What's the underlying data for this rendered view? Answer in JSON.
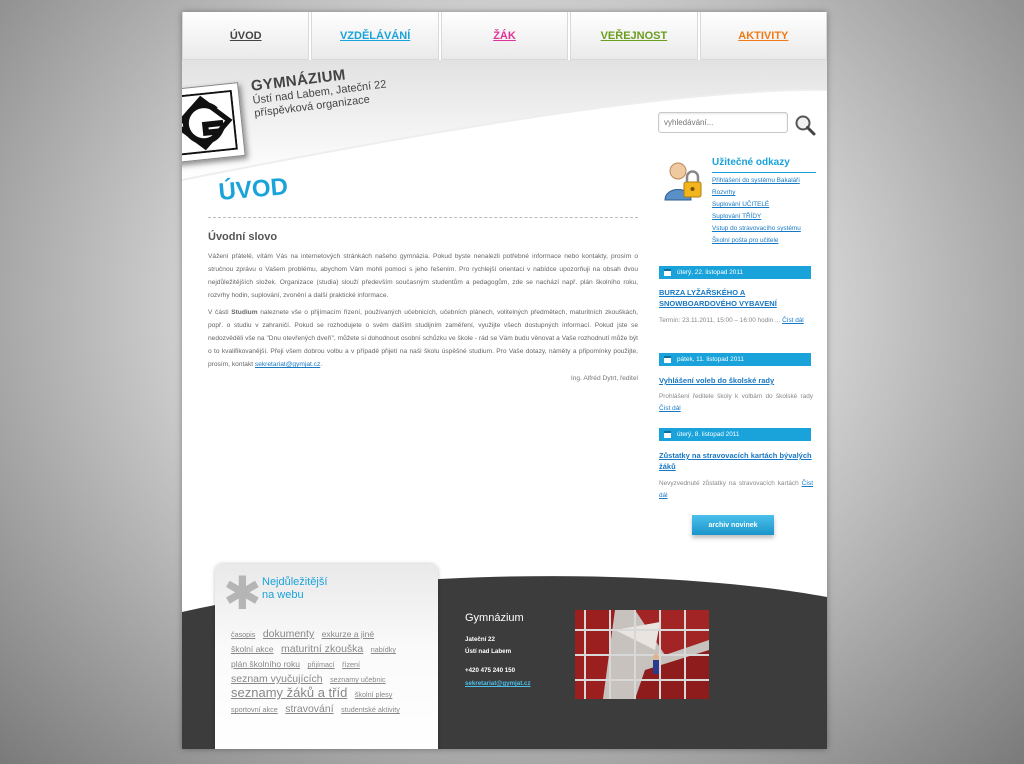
{
  "nav": {
    "tabs": [
      {
        "label": "ÚVOD"
      },
      {
        "label": "VZDĚLÁVÁNÍ"
      },
      {
        "label": "ŽÁK"
      },
      {
        "label": "VEŘEJNOST"
      },
      {
        "label": "AKTIVITY"
      }
    ]
  },
  "header": {
    "school_name": "GYMNÁZIUM",
    "address_line": "Ústí nad Labem, Jateční 22",
    "org_type": "příspěvková organizace"
  },
  "search": {
    "placeholder": "vyhledávání..."
  },
  "main": {
    "page_title": "ÚVOD",
    "heading": "Úvodní slovo",
    "para1": "Vážení přátelé, vítám Vás na internetových stránkách našeho gymnázia. Pokud byste nenalezli potřebné informace nebo kontakty, prosím o stručnou zprávu o Vašem problému, abychom Vám mohli pomoci s jeho řešením. Pro rychlejší orientaci v nabídce upozorňuji na obsah dvou nejdůležitějších složek. Organizace (studia) slouží především současným studentům a pedagogům, zde se nachází např. plán školního roku, rozvrhy hodin, suplování, zvonění a další praktické informace.",
    "para2_start": "V části ",
    "para2_bold": "Studium",
    "para2_text": " naleznete vše o přijímacím řízení, používaných učebnicích, učebních plánech, volitelných předmětech, maturitních zkouškách, popř. o studiu v zahraničí. Pokud se rozhodujete o svém dalším studijním zaměření, využijte všech dostupných informací. Pokud jste se nedozvěděli vše na \"Dnu otevřených dveří\", můžete si dohodnout osobní schůzku ve škole - rád se Vám budu věnovat a Vaše rozhodnutí může být o to kvalifikovanější. Přeji všem dobrou volbu a v případě přijetí na naši školu úspěšné studium. Pro Vaše dotazy, náměty a připomínky použijte, prosím, kontakt ",
    "para2_link": "sekretariat@gymjat.cz",
    "para2_end": ".",
    "signature": "Ing. Alfréd Dytrt, ředitel"
  },
  "useful": {
    "title": "Užitečné odkazy",
    "links": [
      {
        "label": "Přihlášení do systému Bakaláři"
      },
      {
        "label": "Rozvrhy"
      },
      {
        "label": "Suplování UČITELÉ"
      },
      {
        "label": "Suplování TŘÍDY"
      },
      {
        "label": "Vstup do stravovacího systému"
      },
      {
        "label": "Školní pošta pro učitele"
      }
    ]
  },
  "news": [
    {
      "date": "úterý, 22. listopad 2011",
      "title": "BURZA LYŽAŘSKÉHO A SNOWBOARDOVÉHO VYBAVENÍ",
      "body": "Termín: 23.11.2011, 15:00 – 16:00 hodin ...",
      "more": "Číst dál"
    },
    {
      "date": "pátek, 11. listopad 2011",
      "title": "Vyhlášení voleb do školské rady",
      "body": "Prohlášení ředitele školy k volbám do školské rady",
      "more": "Číst dál"
    },
    {
      "date": "úterý, 8. listopad 2011",
      "title": "Zůstatky na stravovacích kartách bývalých žáků",
      "body": "Nevyzvednuté zůstatky na stravovacích kartách",
      "more": "Číst dál"
    }
  ],
  "archive_button": "archiv novinek",
  "tags": {
    "title_line1": "Nejdůležitější",
    "title_line2": "na webu",
    "items": [
      {
        "label": "časopis",
        "size": 1
      },
      {
        "label": "dokumenty",
        "size": 3
      },
      {
        "label": "exkurze a jiné",
        "size": 2
      },
      {
        "label": "školní akce",
        "size": 2
      },
      {
        "label": "maturitní zkouška",
        "size": 3
      },
      {
        "label": "nabídky",
        "size": 1
      },
      {
        "label": "plán školního roku",
        "size": 2
      },
      {
        "label": "přijímací",
        "size": 1
      },
      {
        "label": "řízení",
        "size": 1
      },
      {
        "label": "seznam vyučujících",
        "size": 3
      },
      {
        "label": "seznamy učebnic",
        "size": 1
      },
      {
        "label": "seznamy žáků a tříd",
        "size": 4
      },
      {
        "label": "školní plesy",
        "size": 1
      },
      {
        "label": "sportovní akce",
        "size": 1
      },
      {
        "label": "stravování",
        "size": 3
      },
      {
        "label": "studentské aktivity",
        "size": 1
      }
    ]
  },
  "footer": {
    "school": "Gymnázium",
    "street": "Jateční 22",
    "city": "Ústí nad Labem",
    "phone": "+420 475 240 150",
    "email": "sekretariat@gymjat.cz"
  },
  "colors": {
    "accent": "#19a3da",
    "link": "#1778c4",
    "footer_dark": "#3c3c3c"
  }
}
